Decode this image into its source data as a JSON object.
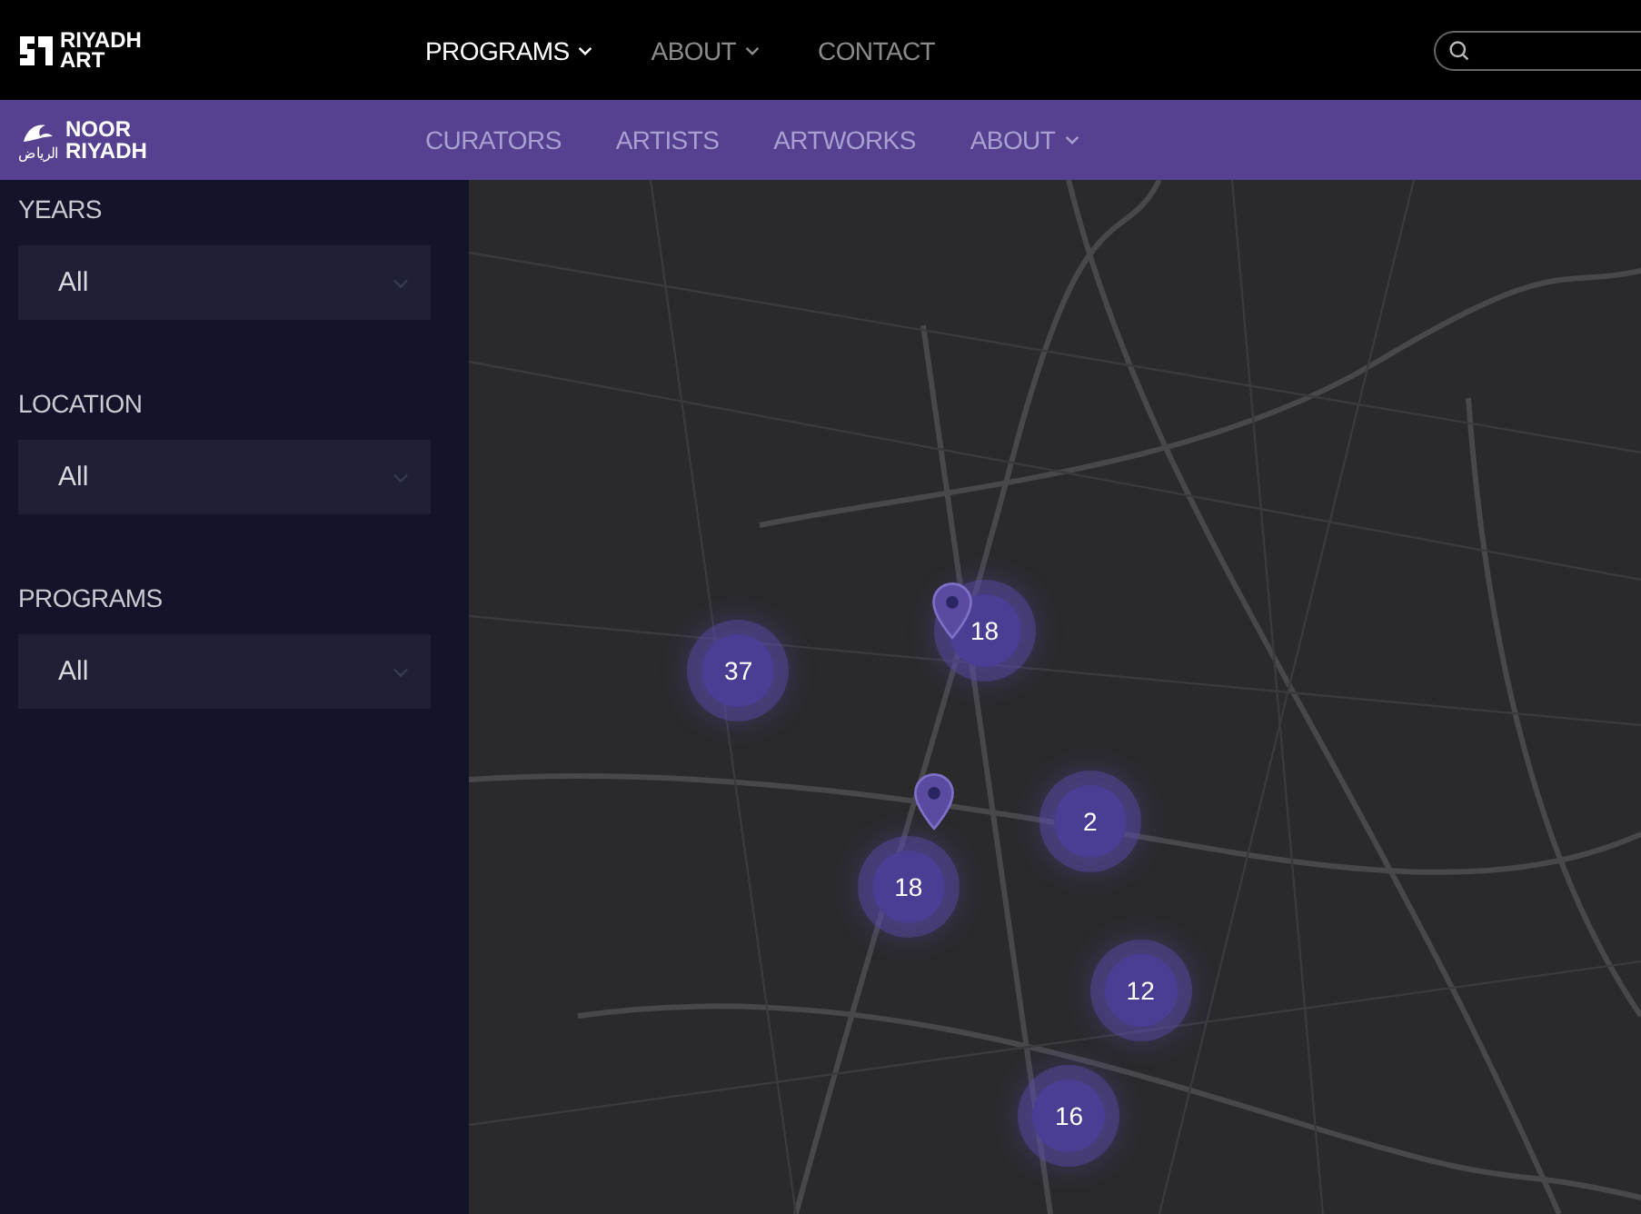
{
  "top_nav": {
    "logo": [
      "RIYADH",
      "ART"
    ],
    "items": [
      {
        "label": "PROGRAMS",
        "selected": true,
        "dropdown": true
      },
      {
        "label": "ABOUT",
        "selected": false,
        "dropdown": true
      },
      {
        "label": "CONTACT",
        "selected": false,
        "dropdown": false
      }
    ]
  },
  "sub_nav": {
    "logo": {
      "arabic": "الرياض",
      "lines": [
        "NOOR",
        "RIYADH"
      ]
    },
    "items": [
      {
        "label": "CURATORS",
        "dropdown": false
      },
      {
        "label": "ARTISTS",
        "dropdown": false
      },
      {
        "label": "ARTWORKS",
        "dropdown": false
      },
      {
        "label": "ABOUT",
        "dropdown": true
      }
    ]
  },
  "filters": [
    {
      "label": "YEARS",
      "value": "All"
    },
    {
      "label": "LOCATION",
      "value": "All"
    },
    {
      "label": "PROGRAMS",
      "value": "All"
    }
  ],
  "map": {
    "clusters": [
      {
        "count": "37"
      },
      {
        "count": "18"
      },
      {
        "count": "2"
      },
      {
        "count": "18"
      },
      {
        "count": "12"
      },
      {
        "count": "16"
      }
    ],
    "markers": [
      {
        "kind": "pin"
      },
      {
        "kind": "pin"
      }
    ]
  }
}
